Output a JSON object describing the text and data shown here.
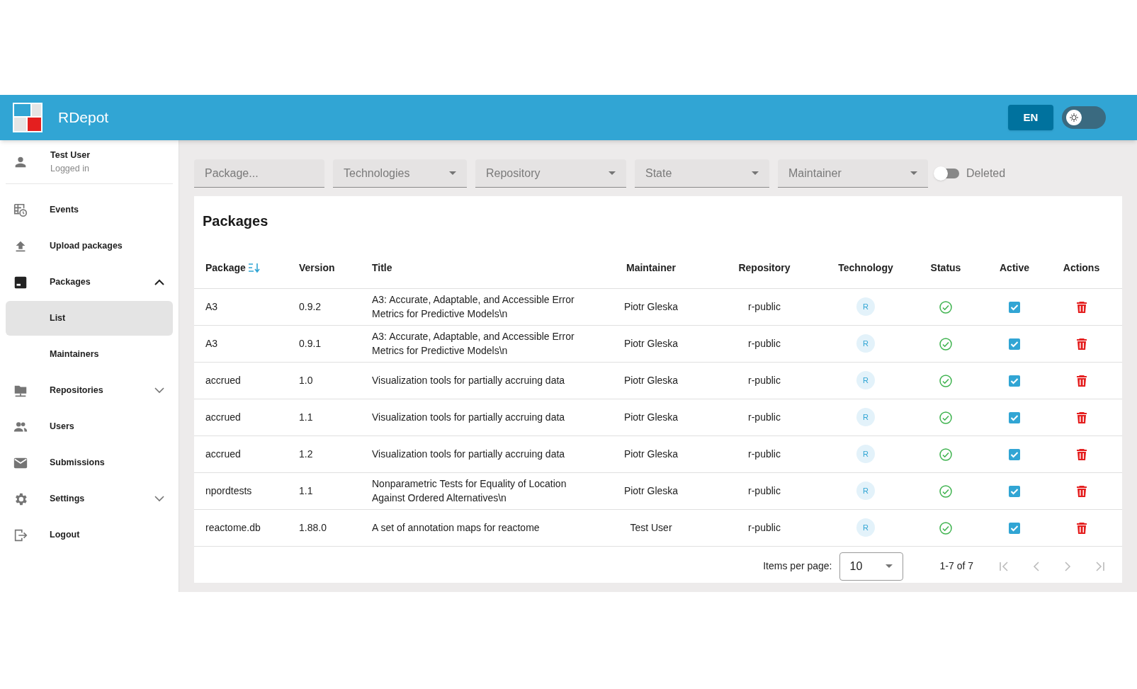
{
  "header": {
    "title": "RDepot",
    "language": "EN",
    "theme_toggle": {
      "on": false
    }
  },
  "user": {
    "name": "Test User",
    "status": "Logged in"
  },
  "sidebar": {
    "items": [
      {
        "label": "Events",
        "kind": "events",
        "selected": false
      },
      {
        "label": "Upload packages",
        "kind": "upload",
        "selected": false
      },
      {
        "label": "Packages",
        "kind": "packages",
        "selected": false,
        "expanded": true,
        "children": [
          {
            "label": "List",
            "selected": true
          },
          {
            "label": "Maintainers",
            "selected": false
          }
        ]
      },
      {
        "label": "Repositories",
        "kind": "repositories",
        "selected": false,
        "expanded": false
      },
      {
        "label": "Users",
        "kind": "users",
        "selected": false
      },
      {
        "label": "Submissions",
        "kind": "submissions",
        "selected": false
      },
      {
        "label": "Settings",
        "kind": "settings",
        "selected": false,
        "expanded": false
      },
      {
        "label": "Logout",
        "kind": "logout",
        "selected": false
      }
    ]
  },
  "filters": {
    "search": {
      "placeholder": "Package..."
    },
    "dropdowns": [
      {
        "placeholder": "Technologies"
      },
      {
        "placeholder": "Repository"
      },
      {
        "placeholder": "State"
      },
      {
        "placeholder": "Maintainer"
      }
    ],
    "deleted": {
      "label": "Deleted",
      "on": false
    }
  },
  "table": {
    "title": "Packages",
    "columns": [
      {
        "label": "Package",
        "sorted": true
      },
      {
        "label": "Version",
        "sorted": false
      },
      {
        "label": "Title",
        "sorted": false
      },
      {
        "label": "Maintainer",
        "sorted": false
      },
      {
        "label": "Repository",
        "sorted": false
      },
      {
        "label": "Technology",
        "sorted": false
      },
      {
        "label": "Status",
        "sorted": false
      },
      {
        "label": "Active",
        "sorted": false
      },
      {
        "label": "Actions",
        "sorted": false
      }
    ],
    "rows": [
      {
        "package": "A3",
        "version": "0.9.2",
        "title": "A3: Accurate, Adaptable, and Accessible Error Metrics for Predictive Models\\n",
        "maintainer": "Piotr Gleska",
        "repository": "r-public",
        "technology": "R",
        "status_ok": true,
        "active": true
      },
      {
        "package": "A3",
        "version": "0.9.1",
        "title": "A3: Accurate, Adaptable, and Accessible Error Metrics for Predictive Models\\n",
        "maintainer": "Piotr Gleska",
        "repository": "r-public",
        "technology": "R",
        "status_ok": true,
        "active": true
      },
      {
        "package": "accrued",
        "version": "1.0",
        "title": "Visualization tools for partially accruing data",
        "maintainer": "Piotr Gleska",
        "repository": "r-public",
        "technology": "R",
        "status_ok": true,
        "active": true
      },
      {
        "package": "accrued",
        "version": "1.1",
        "title": "Visualization tools for partially accruing data",
        "maintainer": "Piotr Gleska",
        "repository": "r-public",
        "technology": "R",
        "status_ok": true,
        "active": true
      },
      {
        "package": "accrued",
        "version": "1.2",
        "title": "Visualization tools for partially accruing data",
        "maintainer": "Piotr Gleska",
        "repository": "r-public",
        "technology": "R",
        "status_ok": true,
        "active": true
      },
      {
        "package": "npordtests",
        "version": "1.1",
        "title": "Nonparametric Tests for Equality of Location Against Ordered Alternatives\\n",
        "maintainer": "Piotr Gleska",
        "repository": "r-public",
        "technology": "R",
        "status_ok": true,
        "active": true
      },
      {
        "package": "reactome.db",
        "version": "1.88.0",
        "title": "A set of annotation maps for reactome",
        "maintainer": "Test User",
        "repository": "r-public",
        "technology": "R",
        "status_ok": true,
        "active": true
      }
    ]
  },
  "pagination": {
    "label": "Items per page:",
    "per_page": "10",
    "range": "1-7 of 7"
  }
}
